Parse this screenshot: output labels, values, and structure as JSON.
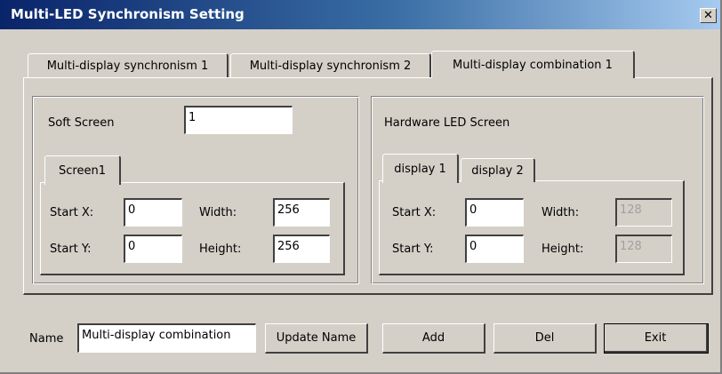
{
  "window": {
    "title": "Multi-LED Synchronism Setting",
    "close_glyph": "✕"
  },
  "tabs": [
    {
      "label": "Multi-display synchronism 1",
      "active": false
    },
    {
      "label": "Multi-display synchronism 2",
      "active": false
    },
    {
      "label": "Multi-display combination 1",
      "active": true
    }
  ],
  "soft_screen": {
    "label": "Soft Screen",
    "value": "1",
    "tab_label": "Screen1",
    "start_x_label": "Start X:",
    "start_x": "0",
    "start_y_label": "Start Y:",
    "start_y": "0",
    "width_label": "Width:",
    "width": "256",
    "height_label": "Height:",
    "height": "256"
  },
  "hardware": {
    "label": "Hardware LED Screen",
    "tabs": [
      {
        "label": "display 1",
        "active": true
      },
      {
        "label": "display 2",
        "active": false
      }
    ],
    "start_x_label": "Start X:",
    "start_x": "0",
    "start_y_label": "Start Y:",
    "start_y": "0",
    "width_label": "Width:",
    "width": "128",
    "height_label": "Height:",
    "height": "128"
  },
  "footer": {
    "name_label": "Name",
    "name_value": "Multi-display combination",
    "update_button": "Update Name",
    "add_button": "Add",
    "del_button": "Del",
    "exit_button": "Exit"
  }
}
